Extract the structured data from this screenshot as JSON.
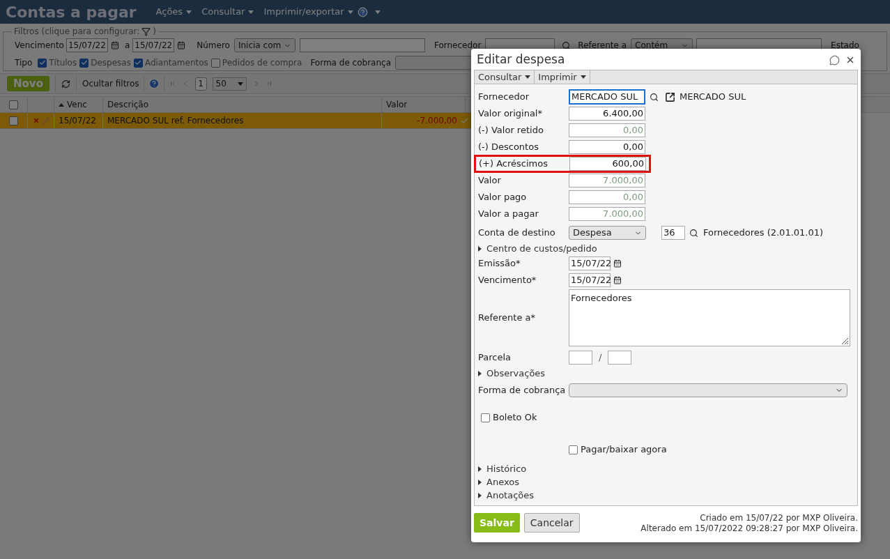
{
  "app": {
    "title": "Contas a pagar",
    "menu": [
      {
        "label": "Ações"
      },
      {
        "label": "Consultar"
      },
      {
        "label": "Imprimir/exportar"
      }
    ]
  },
  "filters": {
    "legend": "Filtros (clique para configurar:",
    "legend_end": ")",
    "vencimento": {
      "label": "Vencimento",
      "from": "15/07/22",
      "between": "a",
      "to": "15/07/22"
    },
    "numero": {
      "label": "Número",
      "mode": "Inicia com"
    },
    "fornecedor": {
      "label": "Fornecedor"
    },
    "referente": {
      "label": "Referente a",
      "mode": "Contém"
    },
    "estado": {
      "label": "Estado"
    },
    "tipo": {
      "label": "Tipo",
      "options": [
        {
          "label": "Títulos",
          "checked": true
        },
        {
          "label": "Despesas",
          "checked": true
        },
        {
          "label": "Adiantamentos",
          "checked": true
        },
        {
          "label": "Pedidos de compra",
          "checked": false
        }
      ]
    },
    "forma": {
      "label": "Forma de cobrança"
    }
  },
  "toolbar": {
    "new": "Novo",
    "hide_filters": "Ocultar filtros",
    "page": "1",
    "per_page": "50"
  },
  "table": {
    "all_checked": false,
    "columns": [
      {
        "label": "Venc",
        "sorted": true
      },
      {
        "label": "Descrição",
        "sorted": false
      },
      {
        "label": "Valor",
        "sorted": false
      }
    ],
    "rows": [
      {
        "checked": false,
        "selected": true,
        "venc": "15/07/22",
        "descricao": "MERCADO SUL ref. Fornecedores",
        "valor": "-7.000,00"
      }
    ]
  },
  "dialog": {
    "title": "Editar despesa",
    "menu": [
      {
        "label": "Consultar"
      },
      {
        "label": "Imprimir"
      }
    ],
    "fields": [
      {
        "kind": "lookup",
        "label": "Fornecedor",
        "value": "MERCADO SUL",
        "link": "MERCADO SUL",
        "focused": true
      },
      {
        "kind": "amount",
        "label": "Valor original*",
        "value": "6.400,00",
        "readonly": false,
        "highlighted": false
      },
      {
        "kind": "amount",
        "label": "(-) Valor retido",
        "value": "0,00",
        "readonly": true,
        "highlighted": false
      },
      {
        "kind": "amount",
        "label": "(-) Descontos",
        "value": "0,00",
        "readonly": false,
        "highlighted": false
      },
      {
        "kind": "amount",
        "label": "(+) Acréscimos",
        "value": "600,00",
        "readonly": false,
        "highlighted": true
      },
      {
        "kind": "amount",
        "label": "Valor",
        "value": "7.000,00",
        "readonly": true,
        "highlighted": false
      },
      {
        "kind": "amount",
        "label": "Valor pago",
        "value": "0,00",
        "readonly": true,
        "highlighted": false
      },
      {
        "kind": "amount",
        "label": "Valor a pagar",
        "value": "7.000,00",
        "readonly": true,
        "highlighted": false
      },
      {
        "kind": "account",
        "label": "Conta de destino",
        "select": "Despesa",
        "code": "36",
        "account": "Fornecedores (2.01.01.01)"
      },
      {
        "kind": "section",
        "label": "Centro de custos/pedido",
        "expanded": false
      },
      {
        "kind": "date",
        "label": "Emissão*",
        "value": "15/07/22"
      },
      {
        "kind": "date",
        "label": "Vencimento*",
        "value": "15/07/22"
      },
      {
        "kind": "textarea",
        "label": "Referente a*",
        "value": "Fornecedores"
      },
      {
        "kind": "parcela",
        "label": "Parcela",
        "separator": "/"
      },
      {
        "kind": "section",
        "label": "Observações",
        "expanded": false
      },
      {
        "kind": "select",
        "label": "Forma de cobrança"
      },
      {
        "kind": "checkbox",
        "label": "Boleto Ok",
        "checked": false
      },
      {
        "kind": "checkbox_aligned",
        "label": "Pagar/baixar agora",
        "checked": false
      },
      {
        "kind": "section",
        "label": "Histórico",
        "expanded": false
      },
      {
        "kind": "section",
        "label": "Anexos",
        "expanded": false
      },
      {
        "kind": "section",
        "label": "Anotações",
        "expanded": false
      }
    ],
    "save": "Salvar",
    "cancel": "Cancelar",
    "created": "Criado em 15/07/22 por MXP Oliveira.",
    "altered": "Alterado em 15/07/2022 09:28:27 por MXP Oliveira."
  }
}
